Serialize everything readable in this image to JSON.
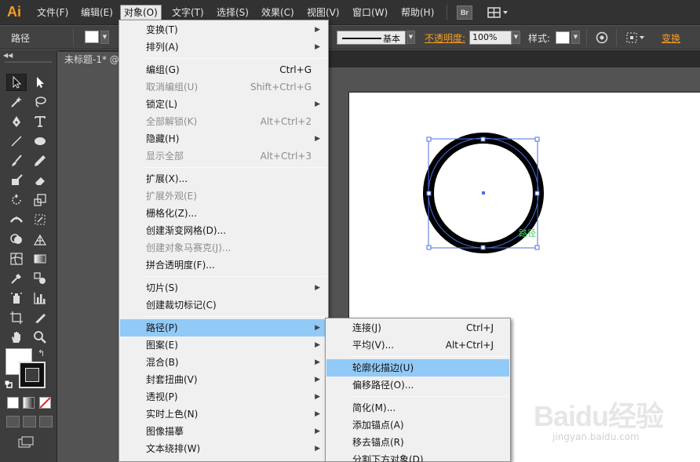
{
  "app": {
    "logo": "Ai"
  },
  "menubar": {
    "items": [
      "文件(F)",
      "编辑(E)",
      "对象(O)",
      "文字(T)",
      "选择(S)",
      "效果(C)",
      "视图(V)",
      "窗口(W)",
      "帮助(H)"
    ],
    "active_index": 2,
    "bridge_label": "Br"
  },
  "controlbar": {
    "selection_label": "路径",
    "stroke_style_label": "基本",
    "opacity_label": "不透明度:",
    "opacity_value": "100%",
    "style_label": "样式:",
    "transform_label": "变换"
  },
  "document": {
    "tab_title": "未标题-1* @"
  },
  "canvas": {
    "path_label": "路径",
    "anchor_color": "#2b5cff"
  },
  "object_menu": [
    {
      "type": "item",
      "label": "变换(T)",
      "submenu": true
    },
    {
      "type": "item",
      "label": "排列(A)",
      "submenu": true
    },
    {
      "type": "sep"
    },
    {
      "type": "item",
      "label": "编组(G)",
      "shortcut": "Ctrl+G"
    },
    {
      "type": "item",
      "label": "取消编组(U)",
      "shortcut": "Shift+Ctrl+G",
      "disabled": true
    },
    {
      "type": "item",
      "label": "锁定(L)",
      "submenu": true
    },
    {
      "type": "item",
      "label": "全部解锁(K)",
      "shortcut": "Alt+Ctrl+2",
      "disabled": true
    },
    {
      "type": "item",
      "label": "隐藏(H)",
      "submenu": true
    },
    {
      "type": "item",
      "label": "显示全部",
      "shortcut": "Alt+Ctrl+3",
      "disabled": true
    },
    {
      "type": "sep"
    },
    {
      "type": "item",
      "label": "扩展(X)..."
    },
    {
      "type": "item",
      "label": "扩展外观(E)",
      "disabled": true
    },
    {
      "type": "item",
      "label": "栅格化(Z)..."
    },
    {
      "type": "item",
      "label": "创建渐变网格(D)..."
    },
    {
      "type": "item",
      "label": "创建对象马赛克(J)...",
      "disabled": true
    },
    {
      "type": "item",
      "label": "拼合透明度(F)..."
    },
    {
      "type": "sep"
    },
    {
      "type": "item",
      "label": "切片(S)",
      "submenu": true
    },
    {
      "type": "item",
      "label": "创建裁切标记(C)"
    },
    {
      "type": "sep"
    },
    {
      "type": "item",
      "label": "路径(P)",
      "submenu": true,
      "highlighted": true
    },
    {
      "type": "item",
      "label": "图案(E)",
      "submenu": true
    },
    {
      "type": "item",
      "label": "混合(B)",
      "submenu": true
    },
    {
      "type": "item",
      "label": "封套扭曲(V)",
      "submenu": true
    },
    {
      "type": "item",
      "label": "透视(P)",
      "submenu": true
    },
    {
      "type": "item",
      "label": "实时上色(N)",
      "submenu": true
    },
    {
      "type": "item",
      "label": "图像描摹",
      "submenu": true
    },
    {
      "type": "item",
      "label": "文本绕排(W)",
      "submenu": true
    }
  ],
  "path_submenu": [
    {
      "type": "item",
      "label": "连接(J)",
      "shortcut": "Ctrl+J"
    },
    {
      "type": "item",
      "label": "平均(V)...",
      "shortcut": "Alt+Ctrl+J"
    },
    {
      "type": "sep"
    },
    {
      "type": "item",
      "label": "轮廓化描边(U)",
      "highlighted": true
    },
    {
      "type": "item",
      "label": "偏移路径(O)..."
    },
    {
      "type": "sep"
    },
    {
      "type": "item",
      "label": "简化(M)..."
    },
    {
      "type": "item",
      "label": "添加锚点(A)"
    },
    {
      "type": "item",
      "label": "移去锚点(R)"
    },
    {
      "type": "item",
      "label": "分割下方对象(D)"
    }
  ],
  "watermark": {
    "brand": "Baidu经验",
    "url": "jingyan.baidu.com"
  }
}
